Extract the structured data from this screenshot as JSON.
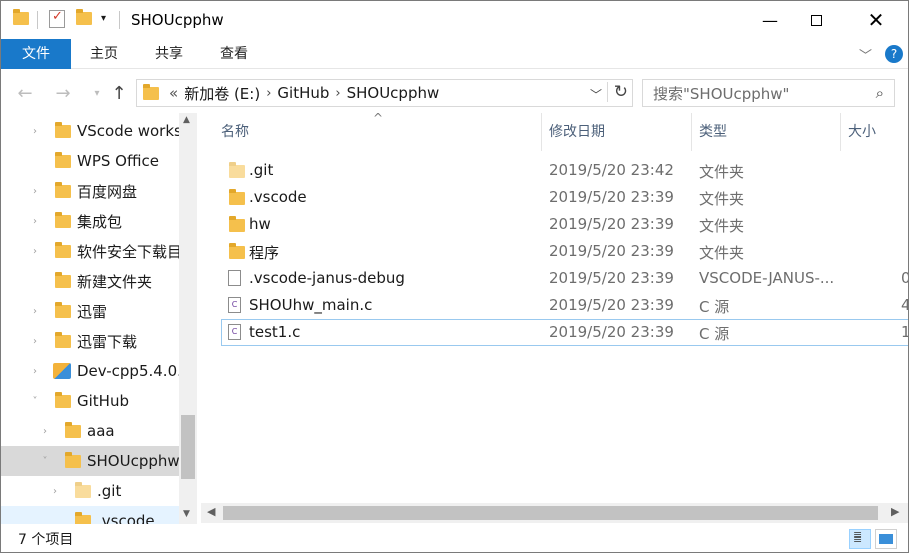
{
  "window": {
    "title": "SHOUcpphw"
  },
  "ribbon": {
    "tabs": [
      "文件",
      "主页",
      "共享",
      "查看"
    ]
  },
  "address": {
    "prefix": "«",
    "crumbs": [
      "新加卷 (E:)",
      "GitHub",
      "SHOUcpphw"
    ]
  },
  "search": {
    "placeholder": "搜索\"SHOUcpphw\""
  },
  "nav": {
    "items": [
      {
        "label": "VScode works"
      },
      {
        "label": "WPS Office"
      },
      {
        "label": "百度网盘"
      },
      {
        "label": "集成包"
      },
      {
        "label": "软件安全下载目"
      },
      {
        "label": "新建文件夹"
      },
      {
        "label": "迅雷"
      },
      {
        "label": "迅雷下载"
      },
      {
        "label": "Dev-cpp5.4.0."
      },
      {
        "label": "GitHub"
      },
      {
        "label": "aaa"
      },
      {
        "label": "SHOUcpphw"
      },
      {
        "label": ".git"
      },
      {
        "label": ".vscode"
      }
    ]
  },
  "columns": {
    "name": "名称",
    "date": "修改日期",
    "type": "类型",
    "size": "大小"
  },
  "files": [
    {
      "name": ".git",
      "date": "2019/5/20 23:42",
      "type": "文件夹",
      "size": "",
      "icon": "folder"
    },
    {
      "name": ".vscode",
      "date": "2019/5/20 23:39",
      "type": "文件夹",
      "size": "",
      "icon": "folder"
    },
    {
      "name": "hw",
      "date": "2019/5/20 23:39",
      "type": "文件夹",
      "size": "",
      "icon": "folder"
    },
    {
      "name": "程序",
      "date": "2019/5/20 23:39",
      "type": "文件夹",
      "size": "",
      "icon": "folder"
    },
    {
      "name": ".vscode-janus-debug",
      "date": "2019/5/20 23:39",
      "type": "VSCODE-JANUS-...",
      "size": "0",
      "icon": "file"
    },
    {
      "name": "SHOUhw_main.c",
      "date": "2019/5/20 23:39",
      "type": "C 源",
      "size": "4",
      "icon": "c-file"
    },
    {
      "name": "test1.c",
      "date": "2019/5/20 23:39",
      "type": "C 源",
      "size": "1",
      "icon": "c-file"
    }
  ],
  "status": {
    "count": "7 个项目"
  }
}
